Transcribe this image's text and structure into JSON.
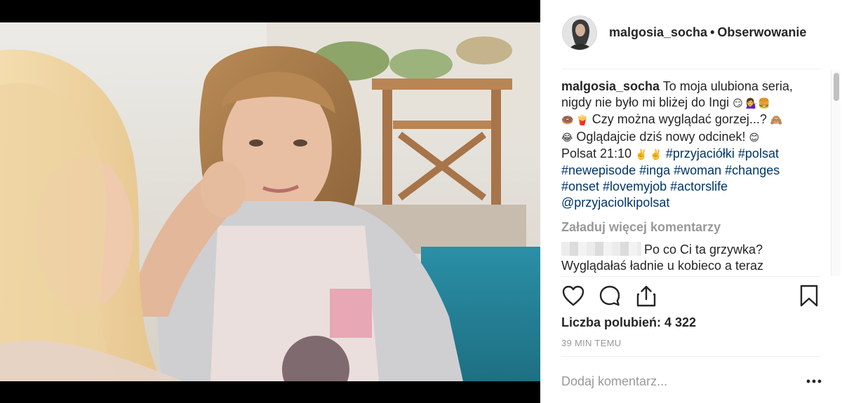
{
  "post": {
    "username": "malgosia_socha",
    "separator": "•",
    "follow_label": "Obserwowanie",
    "caption": {
      "user": "malgosia_socha",
      "line1": "To moja ulubiona seria,",
      "line2": "nigdy nie było mi bliżej do Ingi",
      "emoji1": "😏 💁‍♀️🍔",
      "emoji2": "🍩 🍟",
      "line3": "Czy można wyglądać gorzej...?",
      "emoji3": "🙈",
      "emoji4": "😂",
      "line4": "Oglądajcie dziś nowy odcinek!",
      "emoji5": "😊",
      "line5": "Polsat 21:10",
      "emoji6": "✌️ ✌️",
      "tags1": "#przyjaciółki #polsat",
      "tags2": "#newepisode #inga #woman #changes",
      "tags3": "#onset #lovemyjob #actorslife",
      "mention": "@przyjaciolkipolsat"
    },
    "load_more": "Załaduj więcej komentarzy",
    "comments": [
      {
        "text": "Po co Ci ta grzywka? Wyglądałaś ładnie u kobieco a teraz"
      }
    ],
    "likes": "Liczba polubień: 4 322",
    "time": "39 MIN TEMU",
    "add_comment_placeholder": "Dodaj komentarz...",
    "more_options": "...",
    "icons": {
      "like": "heart-icon",
      "comment": "comment-icon",
      "share": "share-icon",
      "save": "bookmark-icon",
      "more": "more-options-icon"
    }
  }
}
